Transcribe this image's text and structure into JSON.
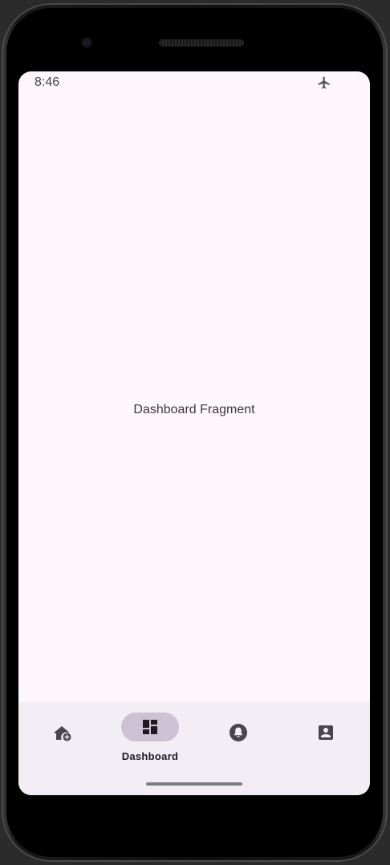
{
  "status_bar": {
    "time": "8:46",
    "airplane_icon": "airplane-icon"
  },
  "main": {
    "fragment_text": "Dashboard Fragment"
  },
  "bottom_nav": {
    "selected": "dashboard",
    "items": [
      {
        "id": "home",
        "label": "Home",
        "icon": "home-add-icon"
      },
      {
        "id": "dashboard",
        "label": "Dashboard",
        "icon": "dashboard-icon"
      },
      {
        "id": "notifications",
        "label": "",
        "icon": "bell-icon"
      },
      {
        "id": "profile",
        "label": "",
        "icon": "account-box-icon"
      }
    ]
  },
  "colors": {
    "screen_background": "#fdf7fb",
    "nav_background": "#f3edf6",
    "active_indicator": "#ccc2d3",
    "icon": "#49454f",
    "active_icon": "#1d1b20"
  }
}
